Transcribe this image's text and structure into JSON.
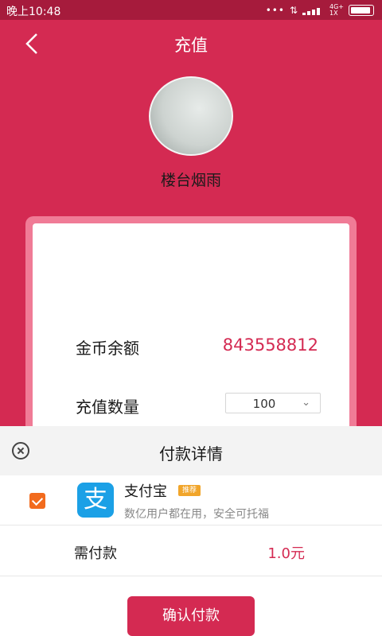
{
  "status_bar": {
    "time": "晚上10:48",
    "dots": "•••",
    "net_top": "4G+",
    "net_bottom": "1X"
  },
  "header": {
    "title": "充值",
    "back_icon": "chevron-left-icon"
  },
  "profile": {
    "username": "楼台烟雨"
  },
  "recharge": {
    "balance_label": "金币余额",
    "balance_value": "843558812",
    "quantity_label": "充值数量",
    "quantity_selected": "100"
  },
  "payment_sheet": {
    "title": "付款详情",
    "method": {
      "name": "支付宝",
      "badge": "推荐",
      "description": "数亿用户都在用，安全可托福",
      "icon_glyph": "支"
    },
    "due_label": "需付款",
    "due_amount": "1.0元",
    "confirm_label": "确认付款"
  },
  "colors": {
    "primary": "#d42a52",
    "card_border": "#f07b96",
    "alipay_blue": "#1ba0e6",
    "checkbox": "#f26b1d"
  }
}
